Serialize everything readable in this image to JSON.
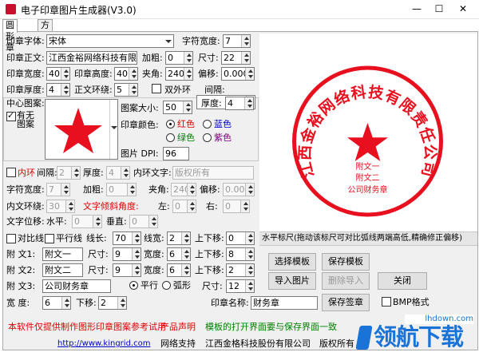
{
  "window": {
    "title": "电子印章图片生成器(V3.0)",
    "min": "—",
    "max": "☐",
    "close": "✕"
  },
  "tabs": [
    "圆形章",
    "方形章"
  ],
  "row1": {
    "font_label": "印章字体:",
    "font_value": "宋体",
    "charw_label": "字符宽度:",
    "charw_value": "7"
  },
  "row2": {
    "text_label": "印章正文:",
    "text_value": "江西金裕网络科技有限责",
    "bold_label": "加粗:",
    "bold_value": "0",
    "size_label": "尺寸:",
    "size_value": "22"
  },
  "row3": {
    "w_label": "印章宽度:",
    "w_value": "40",
    "h_label": "印章高度:",
    "h_value": "40",
    "angle_label": "夹角:",
    "angle_value": "240",
    "offset_label": "偏移:",
    "offset_value": "0.000"
  },
  "row4": {
    "thick_label": "印章厚度:",
    "thick_value": "4",
    "ring_label": "正文环绕:",
    "ring_value": "5",
    "double_label": "双外环",
    "gap_label": "间隔:",
    "gap_value": "2"
  },
  "center": {
    "title": "中心图案:",
    "has_label": "有无图案",
    "size_label": "图案大小:",
    "size_value": "50",
    "thick_label": "厚度:",
    "thick_value": "4",
    "color_label": "印章颜色:",
    "colors": [
      "红色",
      "蓝色",
      "绿色",
      "紫色"
    ],
    "dpi_label": "图片 DPI:",
    "dpi_value": "96"
  },
  "inner": {
    "label": "内环",
    "gap_label": "间隔:",
    "gap_value": "2",
    "thick_label": "厚度:",
    "thick_value": "4",
    "text_label": "内环文字:",
    "text_placeholder": "版权所有",
    "charw_label": "字符宽度:",
    "charw_value": "7",
    "bold_label": "加粗:",
    "bold_value": "0",
    "angle_label": "夹角:",
    "angle_value": "240",
    "offset_label": "偏移:",
    "offset_value": "0.000",
    "wrap_label": "内文环绕:",
    "wrap_value": "30",
    "tilt_label": "文字倾斜角度:",
    "left_label": "左:",
    "left_value": "0",
    "right_label": "右:",
    "right_value": "0",
    "shift_label": "文字位移:",
    "hshift_label": "水平:",
    "hshift_value": "0",
    "vshift_label": "垂直:",
    "vshift_value": "0"
  },
  "lines": {
    "compare_label": "对比线",
    "parallel_label": "平行线",
    "len_label": "线长:",
    "len_value": "70",
    "width_label": "线宽:",
    "width_value": "2",
    "ud_label": "上下移:",
    "ud_value": "0"
  },
  "side": [
    {
      "label": "附  文1:",
      "text": "附文一",
      "size_label": "尺寸:",
      "size_value": "9",
      "w_label": "宽度:",
      "w_value": "6",
      "ud_label": "上下移:",
      "ud_value": "8"
    },
    {
      "label": "附  文2:",
      "text": "附文二",
      "size_label": "尺寸:",
      "size_value": "9",
      "w_label": "宽度:",
      "w_value": "6",
      "ud_label": "上下移:",
      "ud_value": "2"
    }
  ],
  "side3": {
    "label": "附  文3:",
    "text": "公司财务章",
    "opt1": "平行",
    "opt2": "弧形",
    "size_label": "尺寸:",
    "size_value": "12"
  },
  "bottom": {
    "width_label": "宽  度:",
    "width_value": "6",
    "down_label": "下移:",
    "down_value": "2",
    "name_label": "印章名称:",
    "name_value": "财务章",
    "save_btn": "保存签章",
    "bmp_label": "BMP格式"
  },
  "ruler": "水平标尺(拖动该标尺可对比弧线两端高低,精确修正偏移)",
  "buttons": {
    "choose": "选择模板",
    "save_tpl": "保存模板",
    "import": "导入图片",
    "delete_import": "删除导入",
    "close": "关闭"
  },
  "footer": {
    "disclaimer": "本软件仅提供制作图形印章图案参考试用",
    "statement": "产品声明",
    "template_note": "模板的打开界面要与保存界面一致",
    "url": "http://www.kingrid.com",
    "support": "网络支持",
    "company": "江西金格科技股份有限公司",
    "rights": "版权所有"
  },
  "preview": {
    "arc_text": "江西金裕网络科技有限责任公司",
    "line1": "附文一",
    "line2": "附文二",
    "line3": "公司财务章",
    "color": "#e8101e"
  },
  "watermark": {
    "brand": "领航下载",
    "url": "lhdown.com"
  }
}
